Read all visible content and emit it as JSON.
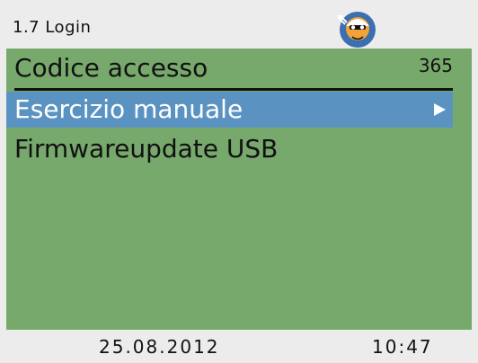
{
  "header": {
    "title": "1.7 Login",
    "icon": "technician-icon"
  },
  "menu": {
    "items": [
      {
        "label": "Codice accesso",
        "value": "365"
      },
      {
        "label": "Esercizio manuale",
        "selected": true,
        "icon": "arrow-right-icon"
      },
      {
        "label": "Firmwareupdate USB"
      }
    ]
  },
  "footer": {
    "date": "25.08.2012",
    "time": "10:47"
  },
  "colors": {
    "background": "#77a86c",
    "selection": "#5a93c1",
    "chrome": "#ececec",
    "icon_blue": "#3b6fb0",
    "icon_orange": "#f2a23a"
  }
}
